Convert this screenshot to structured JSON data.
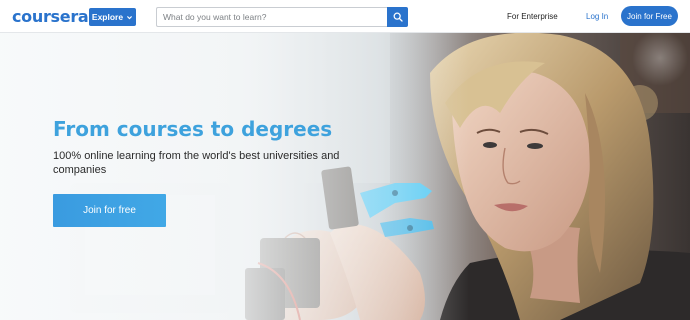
{
  "header": {
    "logo_text": "coursera",
    "explore_label": "Explore",
    "search": {
      "placeholder": "What do you want to learn?",
      "value": ""
    },
    "enterprise_label": "For Enterprise",
    "login_label": "Log In",
    "join_label": "Join for Free",
    "icons": {
      "explore": "chevron-down-icon",
      "search": "search-icon"
    }
  },
  "hero": {
    "title": "From courses to degrees",
    "subtitle": "100% online learning from the world's best universities and companies",
    "cta_label": "Join for free"
  },
  "colors": {
    "brand": "#2a73cc",
    "hero_title": "#3ea2dd",
    "cta": "#3a9be0",
    "robot_arm": "#4fc9f5"
  }
}
